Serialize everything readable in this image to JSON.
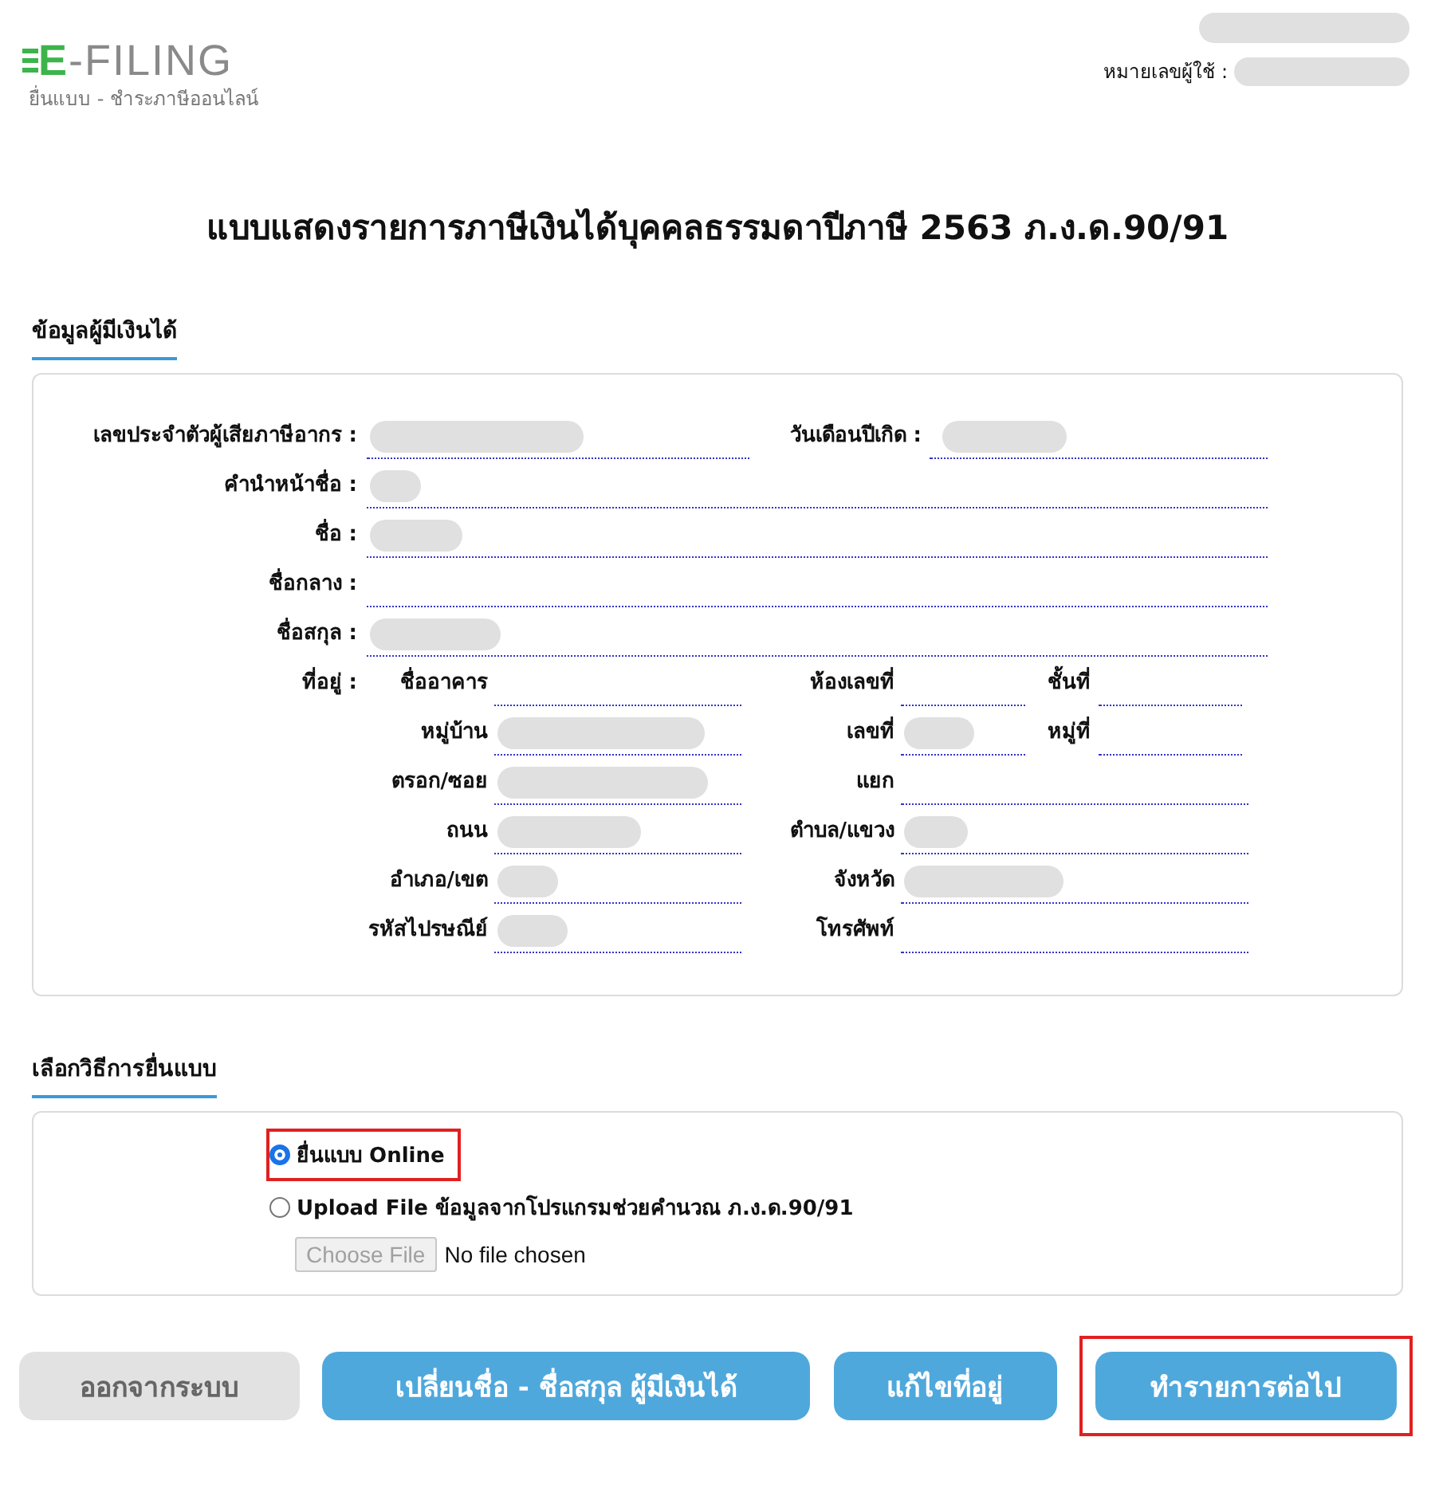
{
  "header": {
    "logo_mark": "E",
    "logo_text": "-FILING",
    "tagline": "ยื่นแบบ - ชำระภาษีออนไลน์",
    "user": {
      "name_redacted": true,
      "id_label": "หมายเลขผู้ใช้ :",
      "id_redacted": true
    }
  },
  "title": "แบบแสดงรายการภาษีเงินได้บุคคลธรรมดาปีภาษี 2563 ภ.ง.ด.90/91",
  "personal": {
    "heading": "ข้อมูลผู้มีเงินได้",
    "rows": [
      {
        "label": "เลขประจำตัวผู้เสียภาษีอากร :",
        "redacted": true,
        "side": {
          "label": "วันเดือนปีเกิด :",
          "redacted": true
        }
      },
      {
        "label": "คำนำหน้าชื่อ :",
        "redacted": true
      },
      {
        "label": "ชื่อ :",
        "redacted": true
      },
      {
        "label": "ชื่อกลาง :",
        "redacted": false
      },
      {
        "label": "ชื่อสกุล :",
        "redacted": true
      }
    ],
    "address": {
      "label": "ที่อยู่ :",
      "rows": [
        {
          "fields": [
            {
              "label": "ชื่ออาคาร",
              "redacted": false
            },
            {
              "label": "ห้องเลขที่",
              "redacted": false
            },
            {
              "label": "ชั้นที่",
              "redacted": false
            }
          ]
        },
        {
          "fields": [
            {
              "label": "หมู่บ้าน",
              "redacted": true
            },
            {
              "label": "เลขที่",
              "redacted": true
            },
            {
              "label": "หมู่ที่",
              "redacted": false
            }
          ]
        },
        {
          "fields": [
            {
              "label": "ตรอก/ซอย",
              "redacted": true
            },
            {
              "label": "แยก",
              "redacted": false
            }
          ]
        },
        {
          "fields": [
            {
              "label": "ถนน",
              "redacted": true
            },
            {
              "label": "ตำบล/แขวง",
              "redacted": true
            }
          ]
        },
        {
          "fields": [
            {
              "label": "อำเภอ/เขต",
              "redacted": true
            },
            {
              "label": "จังหวัด",
              "redacted": true
            }
          ]
        },
        {
          "fields": [
            {
              "label": "รหัสไปรษณีย์",
              "redacted": true
            },
            {
              "label": "โทรศัพท์",
              "redacted": false
            }
          ]
        }
      ]
    }
  },
  "method": {
    "heading": "เลือกวิธีการยื่นแบบ",
    "options": [
      {
        "label": "ยื่นแบบ Online",
        "selected": true,
        "highlighted": true
      },
      {
        "label": "Upload File ข้อมูลจากโปรแกรมช่วยคำนวณ ภ.ง.ด.90/91",
        "selected": false,
        "highlighted": false
      }
    ],
    "file": {
      "button": "Choose File",
      "status": "No file chosen",
      "disabled": true
    }
  },
  "buttons": [
    {
      "label": "ออกจากระบบ",
      "kind": "secondary",
      "highlighted": false
    },
    {
      "label": "เปลี่ยนชื่อ - ชื่อสกุล ผู้มีเงินได้",
      "kind": "primary",
      "highlighted": false
    },
    {
      "label": "แก้ไขที่อยู่",
      "kind": "primary",
      "highlighted": false
    },
    {
      "label": "ทำรายการต่อไป",
      "kind": "primary",
      "highlighted": true
    }
  ]
}
